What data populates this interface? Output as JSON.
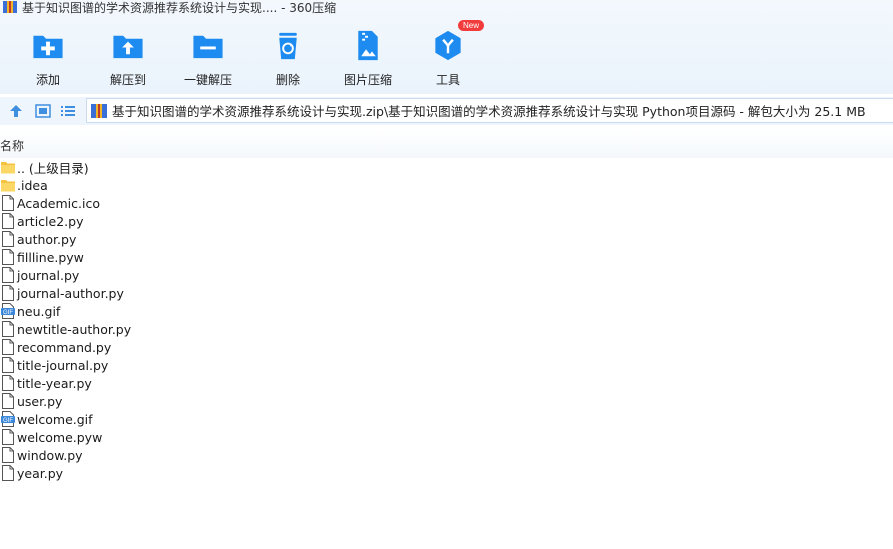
{
  "window": {
    "title": "基于知识图谱的学术资源推荐系统设计与实现.... - 360压缩"
  },
  "toolbar": {
    "items": [
      {
        "label": "添加",
        "icon": "add-icon"
      },
      {
        "label": "解压到",
        "icon": "extract-to-icon"
      },
      {
        "label": "一键解压",
        "icon": "one-click-extract-icon"
      },
      {
        "label": "删除",
        "icon": "recycle-delete-icon"
      },
      {
        "label": "图片压缩",
        "icon": "image-compress-icon"
      },
      {
        "label": "工具",
        "icon": "tools-cube-icon"
      }
    ],
    "new_badge": "New"
  },
  "addressbar": {
    "path": "基于知识图谱的学术资源推荐系统设计与实现.zip\\基于知识图谱的学术资源推荐系统设计与实现 Python项目源码 - 解包大小为 25.1 MB"
  },
  "list": {
    "column_name": "名称",
    "files": [
      {
        "name": ".. (上级目录)",
        "type": "folder"
      },
      {
        "name": ".idea",
        "type": "folder"
      },
      {
        "name": "Academic.ico",
        "type": "file"
      },
      {
        "name": "article2.py",
        "type": "file"
      },
      {
        "name": "author.py",
        "type": "file"
      },
      {
        "name": "fillline.pyw",
        "type": "file"
      },
      {
        "name": "journal.py",
        "type": "file"
      },
      {
        "name": "journal-author.py",
        "type": "file"
      },
      {
        "name": "neu.gif",
        "type": "gif"
      },
      {
        "name": "newtitle-author.py",
        "type": "file"
      },
      {
        "name": "recommand.py",
        "type": "file"
      },
      {
        "name": "title-journal.py",
        "type": "file"
      },
      {
        "name": "title-year.py",
        "type": "file"
      },
      {
        "name": "user.py",
        "type": "file"
      },
      {
        "name": "welcome.gif",
        "type": "gif"
      },
      {
        "name": "welcome.pyw",
        "type": "file"
      },
      {
        "name": "window.py",
        "type": "file"
      },
      {
        "name": "year.py",
        "type": "file"
      }
    ]
  },
  "colors": {
    "accent": "#1e8bf0",
    "folder": "#f5c342",
    "badge": "#f23c3c"
  }
}
